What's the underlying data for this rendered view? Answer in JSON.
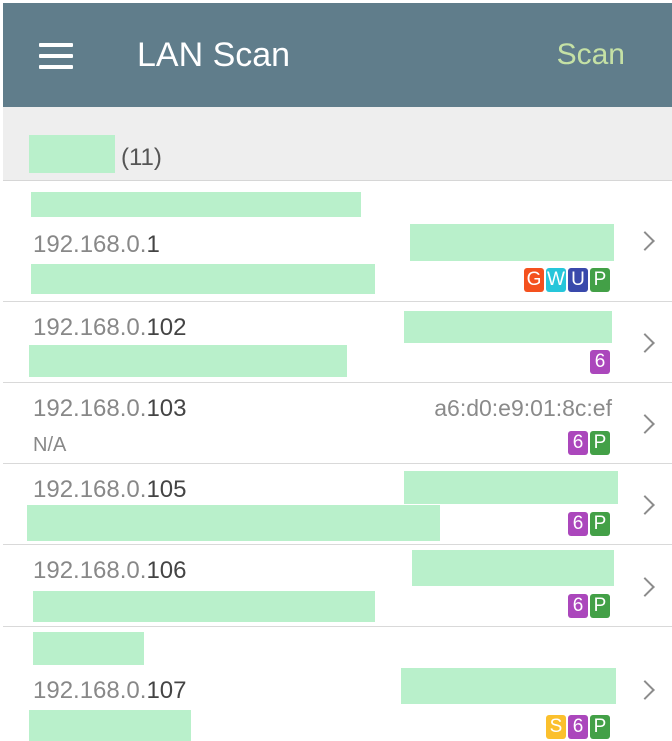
{
  "toolbar": {
    "title": "LAN Scan",
    "scan_label": "Scan"
  },
  "group": {
    "count": "(11)"
  },
  "badge_colors": {
    "G": "#f4511e",
    "W": "#26c6da",
    "U": "#3949ab",
    "P": "#43a047",
    "6": "#ab47bc",
    "S": "#fbc02d"
  },
  "devices": [
    {
      "ip_prefix": "192.168.0.",
      "ip_last": "1",
      "mac": "",
      "sub": "",
      "badges": [
        "G",
        "W",
        "U",
        "P"
      ]
    },
    {
      "ip_prefix": "192.168.0.",
      "ip_last": "102",
      "mac": "",
      "sub": "",
      "badges": [
        "6"
      ]
    },
    {
      "ip_prefix": "192.168.0.",
      "ip_last": "103",
      "mac": "a6:d0:e9:01:8c:ef",
      "sub": "N/A",
      "badges": [
        "6",
        "P"
      ]
    },
    {
      "ip_prefix": "192.168.0.",
      "ip_last": "105",
      "mac": "",
      "sub": "",
      "badges": [
        "6",
        "P"
      ]
    },
    {
      "ip_prefix": "192.168.0.",
      "ip_last": "106",
      "mac": "",
      "sub": "",
      "badges": [
        "6",
        "P"
      ]
    },
    {
      "ip_prefix": "192.168.0.",
      "ip_last": "107",
      "mac": "",
      "sub": "",
      "badges": [
        "S",
        "6",
        "P"
      ]
    }
  ]
}
